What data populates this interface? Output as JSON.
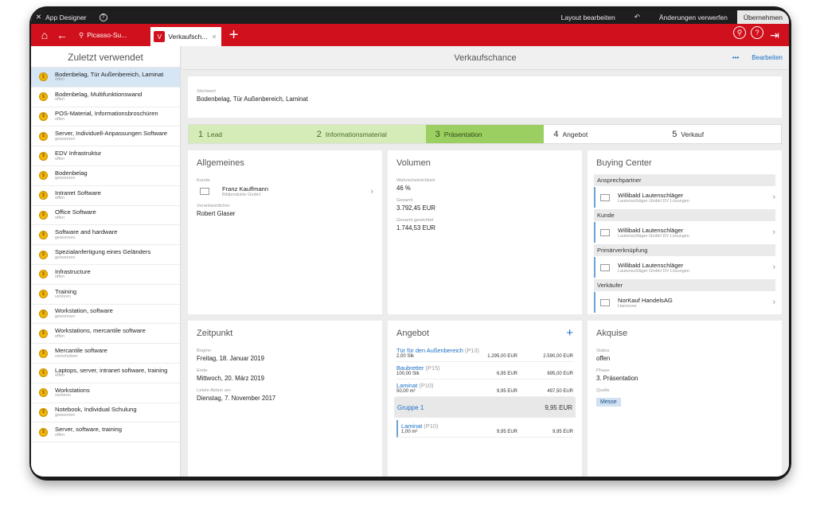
{
  "topbar": {
    "app_name": "App Designer",
    "help": "?",
    "layout_edit": "Layout bearbeiten",
    "undo_icon": "undo-icon",
    "discard": "Änderungen verwerfen",
    "commit": "Übernehmen"
  },
  "navbar": {
    "tab1_label": "Picasso-Su...",
    "tab2_label": "Verkaufsch...",
    "tab2_badge": "V",
    "tab2_close": "×"
  },
  "sidebar": {
    "title": "Zuletzt verwendet",
    "items": [
      {
        "title": "Bodenbelag, Tür Außenbereich, Laminat",
        "status": "offen"
      },
      {
        "title": "Bodenbelag, Multifunktionswand",
        "status": "offen"
      },
      {
        "title": "POS-Material, Informationsbroschüren",
        "status": "offen"
      },
      {
        "title": "Server, Individuell-Anpassungen Software",
        "status": "gewonnen"
      },
      {
        "title": "EDV Infrastruktur",
        "status": "offen"
      },
      {
        "title": "Bodenbelag",
        "status": "gewonnen"
      },
      {
        "title": "Intranet Software",
        "status": "offen"
      },
      {
        "title": "Office Software",
        "status": "offen"
      },
      {
        "title": "Software and hardware",
        "status": "gewonnen"
      },
      {
        "title": "Spezialanfertigung eines Geländers",
        "status": "gewonnen"
      },
      {
        "title": "Infrastructure",
        "status": "offen"
      },
      {
        "title": "Training",
        "status": "verloren"
      },
      {
        "title": "Workstation, software",
        "status": "gewonnen"
      },
      {
        "title": "Workstations, mercantile software",
        "status": "offen"
      },
      {
        "title": "Mercantile software",
        "status": "verschoben"
      },
      {
        "title": "Laptops, server, intranet software, training",
        "status": "offen"
      },
      {
        "title": "Workstations",
        "status": "verloren"
      },
      {
        "title": "Notebook, Individual Schulung",
        "status": "gewonnen"
      },
      {
        "title": "Server, software, training",
        "status": "offen"
      }
    ]
  },
  "header": {
    "title": "Verkaufschance",
    "more": "•••",
    "edit": "Bearbeiten"
  },
  "stichwort": {
    "label": "Stichwort",
    "value": "Bodenbelag, Tür Außenbereich, Laminat"
  },
  "stages": [
    {
      "num": "1",
      "label": "Lead"
    },
    {
      "num": "2",
      "label": "Informationsmaterial"
    },
    {
      "num": "3",
      "label": "Präsentation"
    },
    {
      "num": "4",
      "label": "Angebot"
    },
    {
      "num": "5",
      "label": "Verkauf"
    }
  ],
  "allgemeines": {
    "title": "Allgemeines",
    "kunde_label": "Kunde",
    "kunde_name": "Franz Kauffmann",
    "kunde_company": "Bildprodukte GmbH",
    "verantw_label": "Verantwortlicher",
    "verantw_value": "Robert Glaser"
  },
  "volumen": {
    "title": "Volumen",
    "prob_label": "Wahrscheinlichkeit",
    "prob_value": "46 %",
    "total_label": "Gesamt",
    "total_value": "3.792,45 EUR",
    "weighted_label": "Gesamt gewichtet",
    "weighted_value": "1.744,53 EUR"
  },
  "buying": {
    "title": "Buying Center",
    "groups": [
      {
        "label": "Ansprechpartner",
        "name": "Willibald Lautenschläger",
        "sub": "Lautenschläger GmbH DV Lösungen"
      },
      {
        "label": "Kunde",
        "name": "Willibald Lautenschläger",
        "sub": "Lautenschläger GmbH DV Lösungen"
      },
      {
        "label": "Primärverknüpfung",
        "name": "Willibald Lautenschläger",
        "sub": "Lautenschläger GmbH DV Lösungen"
      },
      {
        "label": "Verkäufer",
        "name": "NorKauf HandelsAG",
        "sub": "Hannover"
      }
    ]
  },
  "zeitpunkt": {
    "title": "Zeitpunkt",
    "begin_label": "Beginn",
    "begin_value": "Freitag, 18. Januar 2019",
    "end_label": "Ende",
    "end_value": "Mittwoch, 20. März 2019",
    "last_label": "Letzte Aktion am",
    "last_value": "Dienstag, 7. November 2017"
  },
  "angebot": {
    "title": "Angebot",
    "add": "+",
    "rows": [
      {
        "name": "Tür für den Außenbereich",
        "code": "(P13)",
        "qty": "2,00 Stk",
        "price": "1.295,00 EUR",
        "total": "2.590,00 EUR"
      },
      {
        "name": "Baubretter",
        "code": "(P15)",
        "qty": "100,00 Stk",
        "price": "6,95 EUR",
        "total": "695,00 EUR"
      },
      {
        "name": "Laminat",
        "code": "(P10)",
        "qty": "50,00 m²",
        "price": "9,95 EUR",
        "total": "497,50 EUR"
      }
    ],
    "group_name": "Gruppe 1",
    "group_value": "9,95 EUR",
    "sub": {
      "name": "Laminat",
      "code": "(P10)",
      "qty": "1,00 m²",
      "price": "9,95 EUR",
      "total": "9,95 EUR"
    }
  },
  "akquise": {
    "title": "Akquise",
    "status_label": "Status",
    "status_value": "offen",
    "phase_label": "Phase",
    "phase_value": "3. Präsentation",
    "quelle_label": "Quelle",
    "quelle_value": "Messe"
  }
}
